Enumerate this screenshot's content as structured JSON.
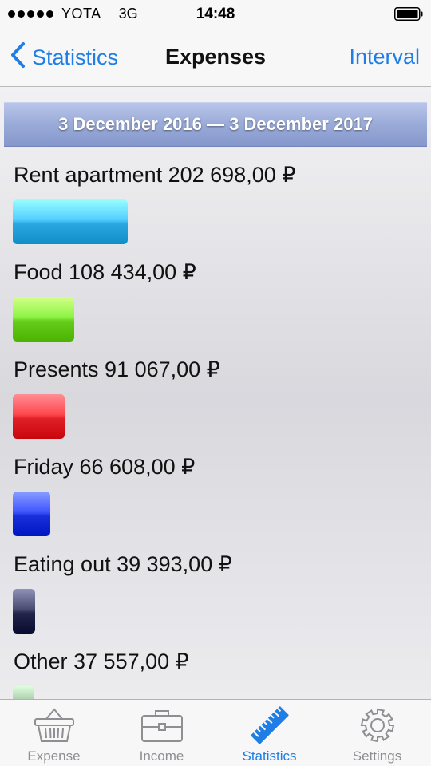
{
  "status_bar": {
    "carrier": "YOTA",
    "network": "3G",
    "time": "14:48"
  },
  "nav": {
    "back_label": "Statistics",
    "title": "Expenses",
    "right_label": "Interval"
  },
  "date_range": "3 December 2016 — 3 December 2017",
  "categories": [
    {
      "label": "Rent apartment 202 698,00 ₽",
      "amount": 202698.0,
      "color": "#2aa6e0"
    },
    {
      "label": "Food 108 434,00 ₽",
      "amount": 108434.0,
      "color": "#66cc1c"
    },
    {
      "label": "Presents 91 067,00 ₽",
      "amount": 91067.0,
      "color": "#e01f26"
    },
    {
      "label": "Friday 66 608,00 ₽",
      "amount": 66608.0,
      "color": "#1a2fdc"
    },
    {
      "label": "Eating out 39 393,00 ₽",
      "amount": 39393.0,
      "color": "#22244a"
    },
    {
      "label": "Other 37 557,00 ₽",
      "amount": 37557.0,
      "color": "#6f8f6f"
    }
  ],
  "tabs": [
    {
      "label": "Expense",
      "icon": "basket-icon",
      "active": false
    },
    {
      "label": "Income",
      "icon": "briefcase-icon",
      "active": false
    },
    {
      "label": "Statistics",
      "icon": "ruler-icon",
      "active": true
    },
    {
      "label": "Settings",
      "icon": "gear-icon",
      "active": false
    }
  ],
  "colors": {
    "accent": "#1f7ee6",
    "range_bar": "#9aabd8",
    "tab_inactive": "#8e8e93"
  }
}
